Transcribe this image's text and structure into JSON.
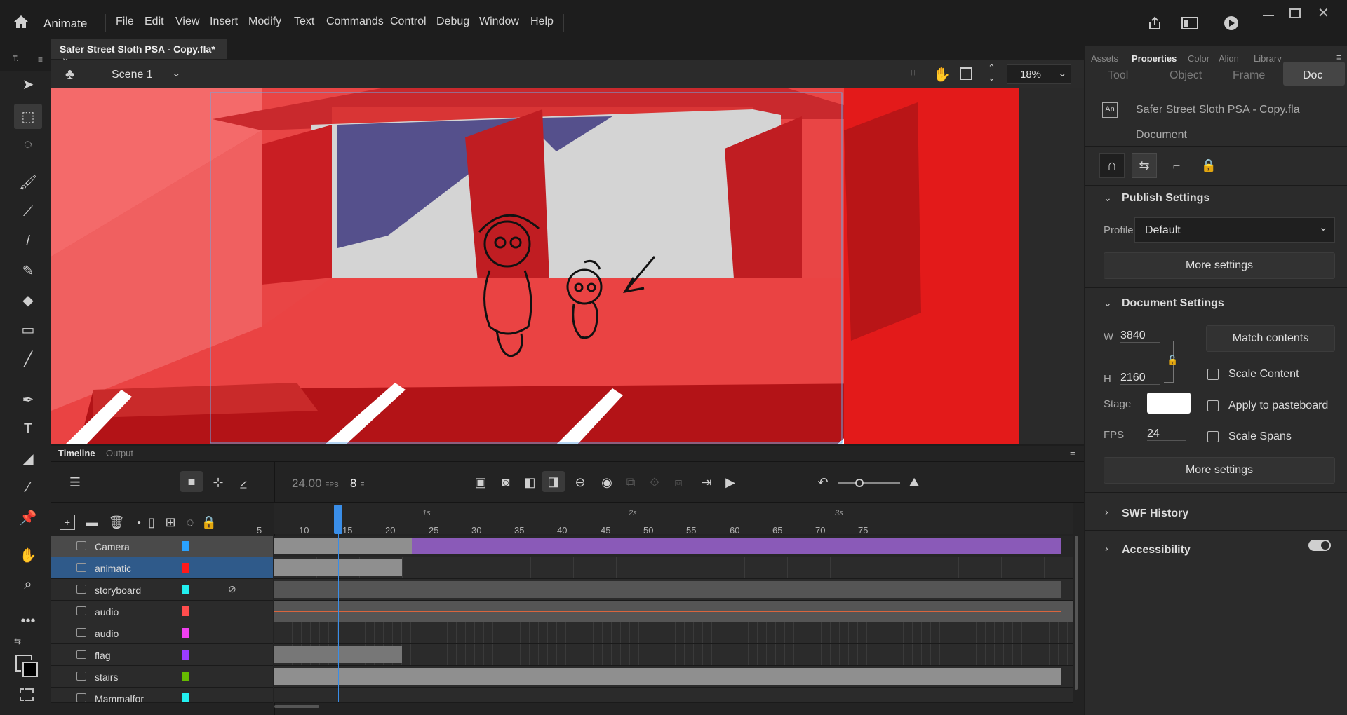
{
  "app": {
    "name": "Animate"
  },
  "menu": [
    "File",
    "Edit",
    "View",
    "Insert",
    "Modify",
    "Text",
    "Commands",
    "Control",
    "Debug",
    "Window",
    "Help"
  ],
  "document": {
    "tab_title": "Safer Street Sloth PSA - Copy.fla*",
    "scene": "Scene 1",
    "zoom": "18%"
  },
  "timeline": {
    "tabs": [
      "Timeline",
      "Output"
    ],
    "fps": "24.00",
    "fps_unit": "FPS",
    "current_frame": "8",
    "frame_unit": "F",
    "ruler_numbers": [
      "5",
      "10",
      "15",
      "20",
      "25",
      "30",
      "35",
      "40",
      "45",
      "50",
      "55",
      "60",
      "65",
      "70",
      "75"
    ],
    "ruler_seconds": [
      "1s",
      "2s",
      "3s"
    ],
    "layers": [
      {
        "name": "Camera",
        "color": "#2aa2ff"
      },
      {
        "name": "animatic",
        "color": "#ff1a1a"
      },
      {
        "name": "storyboard",
        "color": "#22f0f0"
      },
      {
        "name": "audio",
        "color": "#ff4d4d"
      },
      {
        "name": "audio",
        "color": "#f040f0"
      },
      {
        "name": "flag",
        "color": "#9a3cff"
      },
      {
        "name": "stairs",
        "color": "#66bb00"
      },
      {
        "name": "Mammalfor",
        "color": "#22f0f0"
      }
    ]
  },
  "properties": {
    "panel_tabs": [
      "Assets",
      "Properties",
      "Color",
      "Align",
      "Library"
    ],
    "sub_tabs": [
      "Tool",
      "Object",
      "Frame",
      "Doc"
    ],
    "doc_name": "Safer Street Sloth PSA - Copy.fla",
    "doc_type": "Document",
    "doc_badge": "An",
    "publish_settings": {
      "title": "Publish Settings",
      "profile_label": "Profile",
      "profile_value": "Default",
      "more": "More settings"
    },
    "document_settings": {
      "title": "Document Settings",
      "w_label": "W",
      "w_value": "3840",
      "h_label": "H",
      "h_value": "2160",
      "match_contents": "Match contents",
      "scale_content": "Scale Content",
      "apply_pasteboard": "Apply to pasteboard",
      "scale_spans": "Scale Spans",
      "stage_label": "Stage",
      "fps_label": "FPS",
      "fps_value": "24",
      "more": "More settings"
    },
    "swf_history": "SWF History",
    "accessibility": "Accessibility"
  },
  "colors": {
    "accent": "#1473e6",
    "playhead": "#3a8ee8",
    "camera_span": "#8a5ab8"
  }
}
